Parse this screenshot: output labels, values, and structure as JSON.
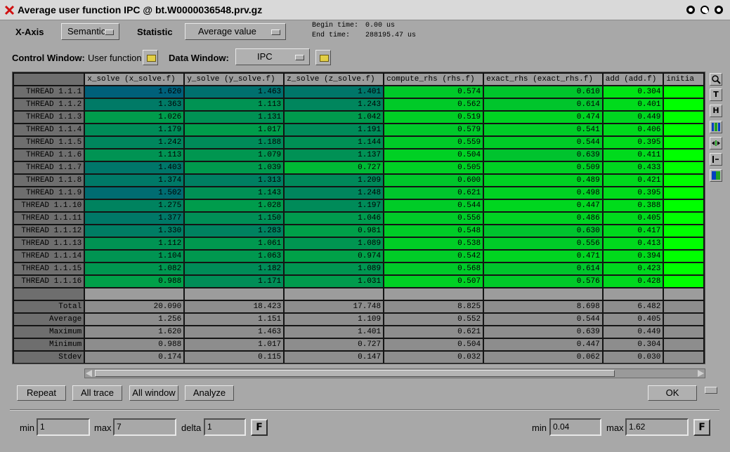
{
  "window": {
    "title": "Average user function IPC @ bt.W0000036548.prv.gz"
  },
  "toolbar": {
    "xaxis_label": "X-Axis",
    "xaxis_value": "Semantic",
    "statistic_label": "Statistic",
    "statistic_value": "Average value",
    "begin_time_label": "Begin time:",
    "begin_time_value": "0.00 us",
    "end_time_label": "End time:",
    "end_time_value": "288195.47 us",
    "control_window_label": "Control Window:",
    "control_window_value": "User function",
    "data_window_label": "Data Window:",
    "data_window_value": "IPC"
  },
  "table": {
    "columns": [
      "x_solve (x_solve.f)",
      "y_solve (y_solve.f)",
      "z_solve (z_solve.f)",
      "compute_rhs (rhs.f)",
      "exact_rhs (exact_rhs.f)",
      "add (add.f)",
      "initia"
    ],
    "rows": [
      {
        "label": "THREAD 1.1.1",
        "values": [
          "1.620",
          "1.463",
          "1.401",
          "0.574",
          "0.610",
          "0.304"
        ]
      },
      {
        "label": "THREAD 1.1.2",
        "values": [
          "1.363",
          "1.113",
          "1.243",
          "0.562",
          "0.614",
          "0.401"
        ]
      },
      {
        "label": "THREAD 1.1.3",
        "values": [
          "1.026",
          "1.131",
          "1.042",
          "0.519",
          "0.474",
          "0.449"
        ]
      },
      {
        "label": "THREAD 1.1.4",
        "values": [
          "1.179",
          "1.017",
          "1.191",
          "0.579",
          "0.541",
          "0.406"
        ]
      },
      {
        "label": "THREAD 1.1.5",
        "values": [
          "1.242",
          "1.188",
          "1.144",
          "0.559",
          "0.544",
          "0.395"
        ]
      },
      {
        "label": "THREAD 1.1.6",
        "values": [
          "1.113",
          "1.079",
          "1.137",
          "0.504",
          "0.639",
          "0.411"
        ]
      },
      {
        "label": "THREAD 1.1.7",
        "values": [
          "1.403",
          "1.039",
          "0.727",
          "0.505",
          "0.509",
          "0.433"
        ]
      },
      {
        "label": "THREAD 1.1.8",
        "values": [
          "1.374",
          "1.313",
          "1.209",
          "0.600",
          "0.489",
          "0.421"
        ]
      },
      {
        "label": "THREAD 1.1.9",
        "values": [
          "1.502",
          "1.143",
          "1.248",
          "0.621",
          "0.498",
          "0.395"
        ]
      },
      {
        "label": "THREAD 1.1.10",
        "values": [
          "1.275",
          "1.028",
          "1.197",
          "0.544",
          "0.447",
          "0.388"
        ]
      },
      {
        "label": "THREAD 1.1.11",
        "values": [
          "1.377",
          "1.150",
          "1.046",
          "0.556",
          "0.486",
          "0.405"
        ]
      },
      {
        "label": "THREAD 1.1.12",
        "values": [
          "1.330",
          "1.283",
          "0.981",
          "0.548",
          "0.630",
          "0.417"
        ]
      },
      {
        "label": "THREAD 1.1.13",
        "values": [
          "1.112",
          "1.061",
          "1.089",
          "0.538",
          "0.556",
          "0.413"
        ]
      },
      {
        "label": "THREAD 1.1.14",
        "values": [
          "1.104",
          "1.063",
          "0.974",
          "0.542",
          "0.471",
          "0.394"
        ]
      },
      {
        "label": "THREAD 1.1.15",
        "values": [
          "1.082",
          "1.182",
          "1.089",
          "0.568",
          "0.614",
          "0.423"
        ]
      },
      {
        "label": "THREAD 1.1.16",
        "values": [
          "0.988",
          "1.171",
          "1.031",
          "0.507",
          "0.576",
          "0.428"
        ]
      }
    ],
    "stats": [
      {
        "label": "Total",
        "values": [
          "20.090",
          "18.423",
          "17.748",
          "8.825",
          "8.698",
          "6.482"
        ]
      },
      {
        "label": "Average",
        "values": [
          "1.256",
          "1.151",
          "1.109",
          "0.552",
          "0.544",
          "0.405"
        ]
      },
      {
        "label": "Maximum",
        "values": [
          "1.620",
          "1.463",
          "1.401",
          "0.621",
          "0.639",
          "0.449"
        ]
      },
      {
        "label": "Minimum",
        "values": [
          "0.988",
          "1.017",
          "0.727",
          "0.504",
          "0.447",
          "0.304"
        ]
      },
      {
        "label": "Stdev",
        "values": [
          "0.174",
          "0.115",
          "0.147",
          "0.032",
          "0.062",
          "0.030"
        ]
      }
    ],
    "scale_min": 0.04,
    "scale_max": 1.62,
    "colors": {
      "low": "#00ff00",
      "high": "#00607a"
    }
  },
  "actions": {
    "repeat": "Repeat",
    "all_trace": "All trace",
    "all_window": "All window",
    "analyze": "Analyze",
    "ok": "OK"
  },
  "bottom": {
    "min_label": "min",
    "min_value": "1",
    "max_label": "max",
    "max_value": "7",
    "delta_label": "delta",
    "delta_value": "1",
    "f_label": "F",
    "gmin_label": "min",
    "gmin_value": "0.04",
    "gmax_label": "max",
    "gmax_value": "1.62",
    "gf_label": "F"
  },
  "sidebar": {
    "tools": [
      "zoom-icon",
      "T",
      "H",
      "color-bars-icon",
      "fit-icon",
      "sort-icon",
      "gradient-icon"
    ]
  }
}
